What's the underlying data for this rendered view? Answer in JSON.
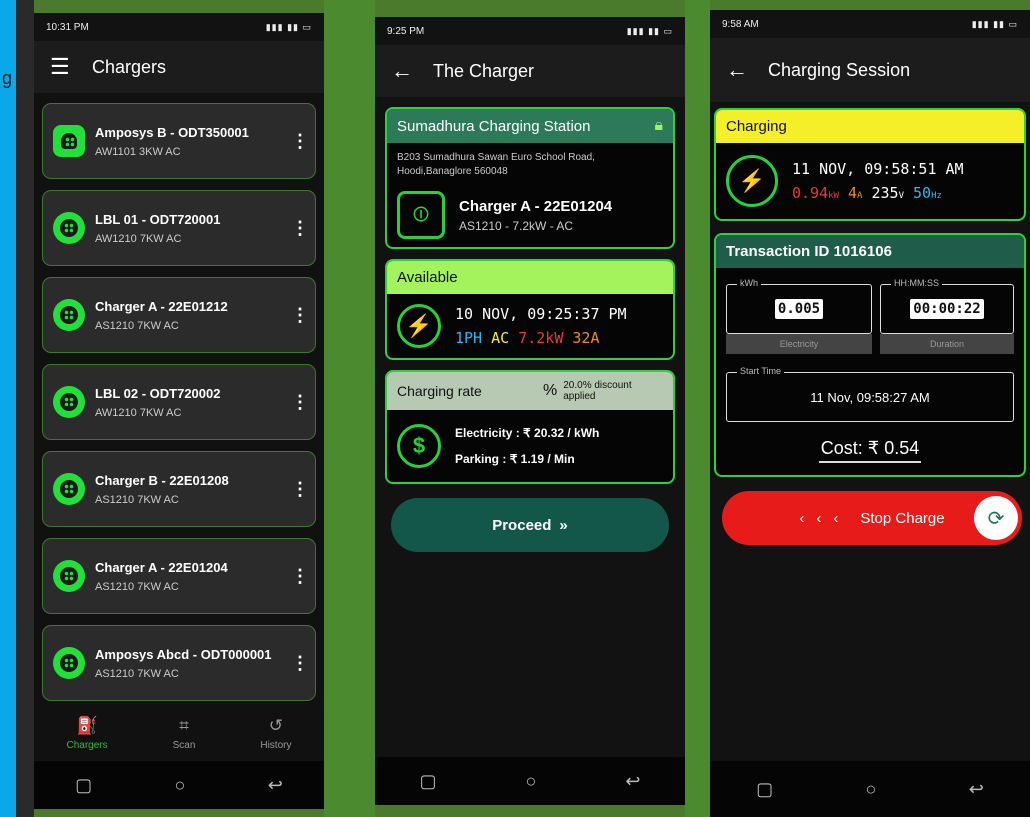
{
  "bg_fragment": {
    "top": "g",
    "mid": "y",
    "low": "."
  },
  "phone1": {
    "time": "10:31 PM",
    "title": "Chargers",
    "chargers": [
      {
        "name": "Amposys B - ODT350001",
        "spec": "AW1101 3KW AC"
      },
      {
        "name": "LBL 01 - ODT720001",
        "spec": "AW1210 7KW AC"
      },
      {
        "name": "Charger A - 22E01212",
        "spec": "AS1210 7KW AC"
      },
      {
        "name": "LBL 02 - ODT720002",
        "spec": "AW1210 7KW AC"
      },
      {
        "name": "Charger B - 22E01208",
        "spec": "AS1210 7KW AC"
      },
      {
        "name": "Charger A - 22E01204",
        "spec": "AS1210 7KW AC"
      },
      {
        "name": "Amposys Abcd - ODT000001",
        "spec": "AS1210 7KW AC"
      }
    ],
    "nav": {
      "chargers": "Chargers",
      "scan": "Scan",
      "history": "History"
    }
  },
  "phone2": {
    "time": "9:25 PM",
    "title": "The Charger",
    "station": "Sumadhura Charging Station",
    "address": "B203 Sumadhura Sawan Euro School Road, Hoodi,Banaglore 560048",
    "charger_name": "Charger A - 22E01204",
    "charger_spec": "AS1210 - 7.2kW - AC",
    "status": "Available",
    "datetime": "10 NOV, 09:25:37 PM",
    "phase": "1PH",
    "ac": "AC",
    "power": "7.2kW",
    "amps": "32A",
    "rate_title": "Charging rate",
    "discount": "20.0% discount applied",
    "electricity_label": "Electricity :",
    "electricity_value": "₹ 20.32",
    "electricity_unit": "/ kWh",
    "parking_label": "Parking :",
    "parking_value": "₹ 1.19",
    "parking_unit": "/ Min",
    "proceed": "Proceed"
  },
  "phone3": {
    "time": "9:58 AM",
    "title": "Charging Session",
    "status": "Charging",
    "datetime": "11 NOV, 09:58:51 AM",
    "kw": "0.94",
    "kw_unit": "kW",
    "amps": "4",
    "amps_unit": "A",
    "volts": "235",
    "volts_unit": "V",
    "hz": "50",
    "hz_unit": "Hz",
    "transaction": "Transaction ID 1016106",
    "kwh_label": "kWh",
    "kwh_value": "0.005",
    "electricity_caption": "Electricity",
    "duration_label": "HH:MM:SS",
    "duration_value": "00:00:22",
    "duration_caption": "Duration",
    "start_label": "Start Time",
    "start_value": "11 Nov, 09:58:27 AM",
    "cost": "Cost: ₹ 0.54",
    "stop": "Stop Charge"
  },
  "colors": {
    "accent": "#27d13a",
    "lime": "#a4f25c",
    "yellow": "#f4ef28",
    "red": "#e81b1b",
    "teal": "#13574b"
  }
}
